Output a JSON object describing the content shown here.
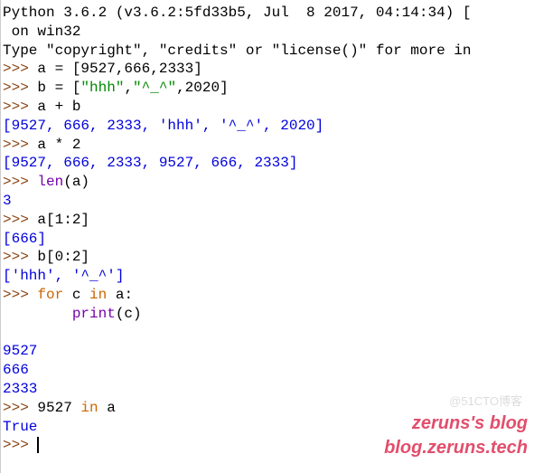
{
  "header": {
    "line1": "Python 3.6.2 (v3.6.2:5fd33b5, Jul  8 2017, 04:14:34) [",
    "line2": " on win32",
    "line3": "Type \"copyright\", \"credits\" or \"license()\" for more in"
  },
  "prompt": ">>> ",
  "indent": "        ",
  "inputs": {
    "assign_a": {
      "var": "a = [",
      "vals": "9527,666,2333",
      "close": "]"
    },
    "assign_b": {
      "var": "b = [",
      "s1": "\"hhh\"",
      "c1": ",",
      "s2": "\"^_^\"",
      "c2": ",",
      "v": "2020",
      "close": "]"
    },
    "plus": "a + b",
    "times": {
      "a": "a * ",
      "n": "2"
    },
    "len": {
      "fn": "len",
      "arg": "(a)"
    },
    "slice_a": {
      "var": "a[",
      "idx": "1:2",
      "close": "]"
    },
    "slice_b": {
      "var": "b[",
      "idx": "0:2",
      "close": "]"
    },
    "for": {
      "kw1": "for",
      "mid": " c ",
      "kw2": "in",
      "end": " a:"
    },
    "print": {
      "fn": "print",
      "arg": "(c)"
    },
    "in_test": {
      "n": "9527",
      "sp": " ",
      "kw": "in",
      "end": " a"
    }
  },
  "outputs": {
    "plus": "[9527, 666, 2333, 'hhh', '^_^', 2020]",
    "times": "[9527, 666, 2333, 9527, 666, 2333]",
    "len": "3",
    "slice_a": "[666]",
    "slice_b": "['hhh', '^_^']",
    "loop1": "9527",
    "loop2": "666",
    "loop3": "2333",
    "in_test": "True"
  },
  "watermark": {
    "l1": "zeruns's blog",
    "l2": "blog.zeruns.tech"
  },
  "faint": "@51CTO博客"
}
